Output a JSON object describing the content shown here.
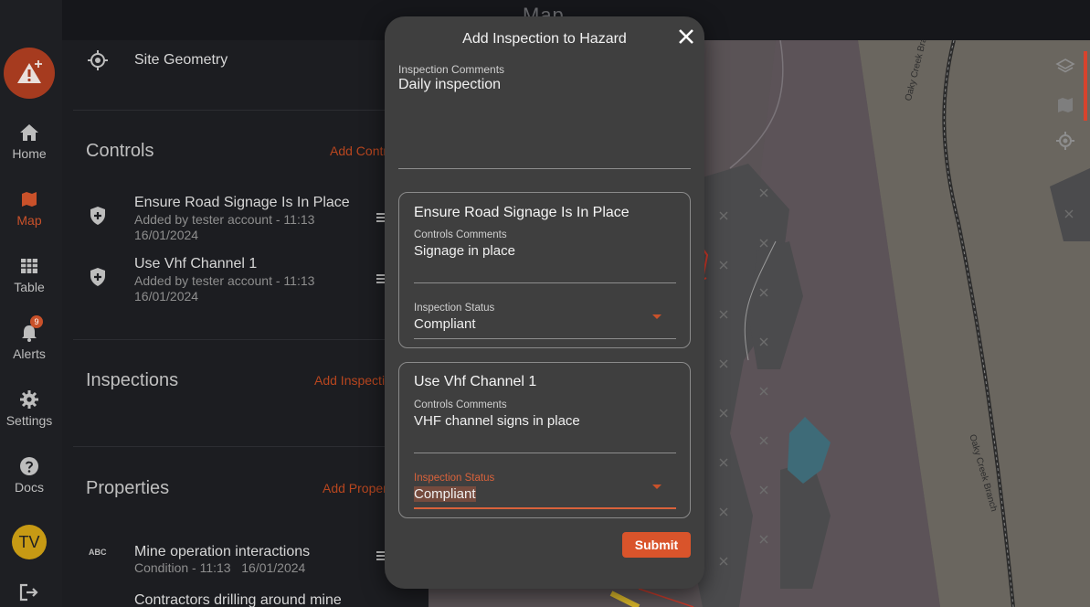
{
  "header": {
    "title": "Map"
  },
  "nav": {
    "items": [
      {
        "label": "Home",
        "icon": "home-icon"
      },
      {
        "label": "Map",
        "icon": "map-icon",
        "active": true
      },
      {
        "label": "Table",
        "icon": "table-icon"
      },
      {
        "label": "Alerts",
        "icon": "bell-icon",
        "badge": "9"
      },
      {
        "label": "Settings",
        "icon": "gear-icon"
      },
      {
        "label": "Docs",
        "icon": "help-icon"
      }
    ],
    "avatar": "TV"
  },
  "panel": {
    "site_geometry": "Site Geometry",
    "controls": {
      "heading": "Controls",
      "add_link": "Add Contr",
      "items": [
        {
          "title": "Ensure Road Signage Is In Place",
          "meta1": "Added by tester account - 11:13",
          "meta2": "16/01/2024"
        },
        {
          "title": "Use Vhf Channel 1",
          "meta1": "Added by tester account - 11:13",
          "meta2": "16/01/2024"
        }
      ]
    },
    "inspections": {
      "heading": "Inspections",
      "add_link": "Add Inspecti"
    },
    "properties": {
      "heading": "Properties",
      "add_link": "Add Proper",
      "items": [
        {
          "icon_text": "ABC",
          "title": "Mine operation interactions",
          "meta": "Condition - 11:13   16/01/2024"
        },
        {
          "title": "Contractors drilling around mine"
        }
      ]
    }
  },
  "map": {
    "labels": [
      "Oaky Creek Branch",
      "Oaky Creek Branch"
    ],
    "colors": {
      "land": "#5a5356",
      "block": "#4a4a4a",
      "light": "#6e6a62",
      "water": "#3e6b78",
      "rail": "#2a2a2a"
    }
  },
  "modal": {
    "title": "Add Inspection to Hazard",
    "comments_label": "Inspection Comments",
    "comments_value": "Daily inspection",
    "controls": [
      {
        "title": "Ensure Road Signage Is In Place",
        "comments_label": "Controls Comments",
        "comments_value": "Signage in place",
        "status_label": "Inspection Status",
        "status_value": "Compliant"
      },
      {
        "title": "Use Vhf Channel 1",
        "comments_label": "Controls Comments",
        "comments_value": "VHF channel signs in place",
        "status_label": "Inspection Status",
        "status_value": "Compliant"
      }
    ],
    "submit_label": "Submit"
  }
}
